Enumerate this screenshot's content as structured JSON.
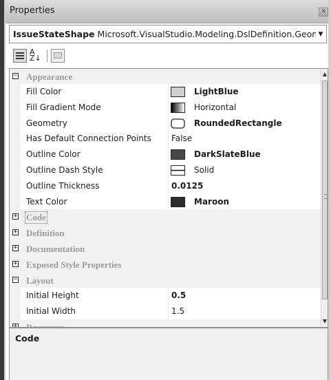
{
  "window": {
    "title": "Properties",
    "close_glyph": "✕"
  },
  "object_selector": {
    "name": "IssueStateShape",
    "type": "Microsoft.VisualStudio.Modeling.DslDefinition.Geome",
    "dropdown_glyph": "▼"
  },
  "toolbar": {
    "categorized_icon": "categorized-icon",
    "alphabetical_icon": "alphabetical-sort-icon",
    "alphabetical_top": "A",
    "alphabetical_bottom": "Z↓",
    "property_pages_icon": "property-pages-icon"
  },
  "grid": {
    "appearance": {
      "label": "Appearance",
      "expander": "−",
      "props": [
        {
          "name": "Fill Color",
          "value": "LightBlue",
          "swatch": "#cfcfcf",
          "bold": true
        },
        {
          "name": "Fill Gradient Mode",
          "value": "Horizontal",
          "swatch": "gradient",
          "bold": false
        },
        {
          "name": "Geometry",
          "value": "RoundedRectangle",
          "swatch": "rounded",
          "bold": true
        },
        {
          "name": "Has Default Connection Points",
          "value": "False",
          "bold": false
        },
        {
          "name": "Outline Color",
          "value": "DarkSlateBlue",
          "swatch": "#484848",
          "bold": true
        },
        {
          "name": "Outline Dash Style",
          "value": "Solid",
          "swatch": "line",
          "bold": false
        },
        {
          "name": "Outline Thickness",
          "value": "0.0125",
          "bold": true
        },
        {
          "name": "Text Color",
          "value": "Maroon",
          "swatch": "#2b2b2b",
          "bold": true
        }
      ]
    },
    "code": {
      "label": "Code",
      "expander": "+"
    },
    "definition": {
      "label": "Definition",
      "expander": "+"
    },
    "documentation": {
      "label": "Documentation",
      "expander": "+"
    },
    "exposed_style": {
      "label": "Exposed Style Properties",
      "expander": "+"
    },
    "layout": {
      "label": "Layout",
      "expander": "−",
      "props": [
        {
          "name": "Initial Height",
          "value": "0.5",
          "bold": true
        },
        {
          "name": "Initial Width",
          "value": "1.5",
          "bold": false
        }
      ]
    },
    "resources": {
      "label": "Resources",
      "expander": "+"
    }
  },
  "scrollbar": {
    "up_glyph": "▲",
    "down_glyph": "▼"
  },
  "description": {
    "title": "Code"
  }
}
